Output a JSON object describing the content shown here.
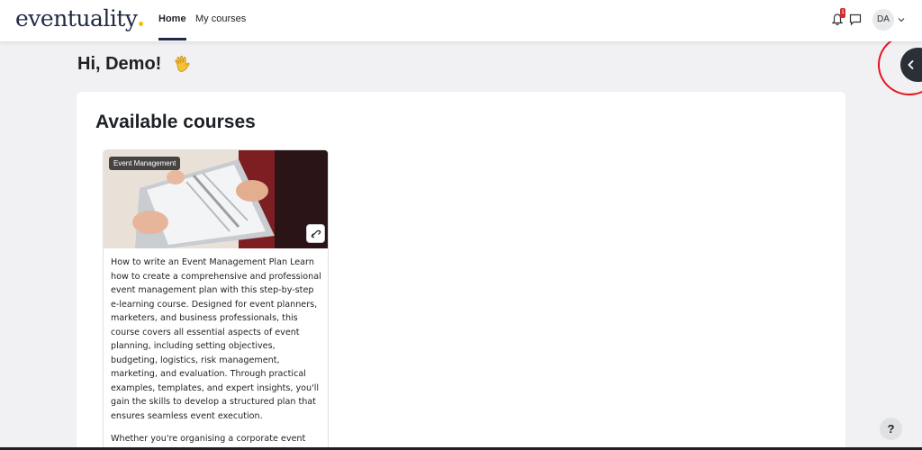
{
  "navbar": {
    "brand": "eventuality",
    "links": [
      {
        "label": "Home",
        "active": true
      },
      {
        "label": "My courses",
        "active": false
      }
    ],
    "notifications": {
      "icon": "bell-icon",
      "count": "1"
    },
    "messages": {
      "icon": "chat-icon"
    },
    "user": {
      "initials": "DA"
    }
  },
  "greeting": {
    "text": "Hi, Demo!",
    "emoji": "waving-hand-icon"
  },
  "section": {
    "title": "Available courses"
  },
  "courses": [
    {
      "category": "Event Management",
      "description": [
        "How to write an Event Management Plan Learn how to create a comprehensive and professional event management plan with this step-by-step e-learning course. Designed for event planners, marketers, and business professionals, this course covers all essential aspects of event planning, including setting objectives, budgeting, logistics, risk management, marketing, and evaluation. Through practical examples, templates, and expert insights, you'll gain the skills to develop a structured plan that ensures seamless event execution.",
        "Whether you're organising a corporate event"
      ]
    }
  ],
  "help": {
    "label": "?"
  },
  "colors": {
    "brand": "#1f2a44",
    "brand_dot": "#f2c200",
    "badge": "#d32f2f",
    "highlight_ring": "#e3141b",
    "drawer": "#2b3038"
  }
}
